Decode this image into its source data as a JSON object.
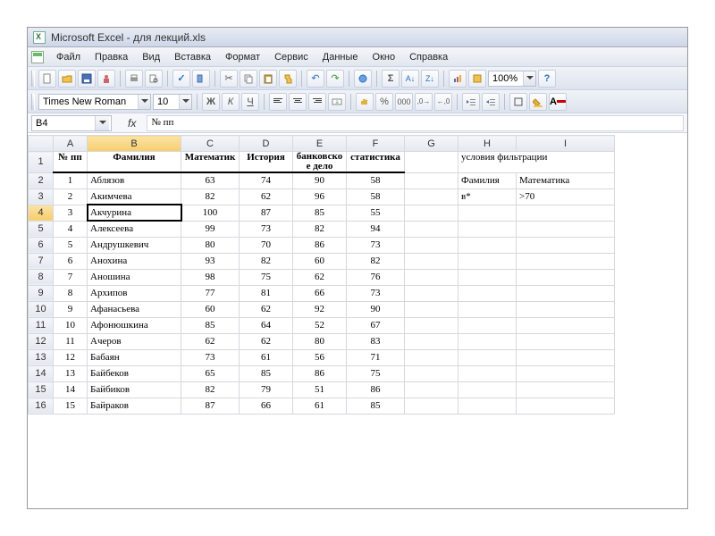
{
  "title": "Microsoft Excel - для лекций.xls",
  "menus": [
    "Файл",
    "Правка",
    "Вид",
    "Вставка",
    "Формат",
    "Сервис",
    "Данные",
    "Окно",
    "Справка"
  ],
  "zoom": "100%",
  "font": {
    "name": "Times New Roman",
    "size": "10"
  },
  "namebox": "B4",
  "fx_label": "fx",
  "formula": "№ пп",
  "columns": [
    "A",
    "B",
    "C",
    "D",
    "E",
    "F",
    "G",
    "H",
    "I"
  ],
  "header_row": {
    "A": "№ пп",
    "B": "Фамилия",
    "C": "Математика",
    "D": "История",
    "E": "банковское дело",
    "F": "статистика",
    "H_caption": "условия фильтрации"
  },
  "filter_row": {
    "H": "Фамилия",
    "I": "Математика"
  },
  "filter_row2": {
    "H": "в*",
    "I": ">70"
  },
  "rows": [
    {
      "n": 1,
      "name": "Аблязов",
      "m": 63,
      "h": 74,
      "b": 90,
      "s": 58
    },
    {
      "n": 2,
      "name": "Акимчева",
      "m": 82,
      "h": 62,
      "b": 96,
      "s": 58
    },
    {
      "n": 3,
      "name": "Акчурина",
      "m": 100,
      "h": 87,
      "b": 85,
      "s": 55
    },
    {
      "n": 4,
      "name": "Алексеева",
      "m": 99,
      "h": 73,
      "b": 82,
      "s": 94
    },
    {
      "n": 5,
      "name": "Андрушкевич",
      "m": 80,
      "h": 70,
      "b": 86,
      "s": 73
    },
    {
      "n": 6,
      "name": "Анохина",
      "m": 93,
      "h": 82,
      "b": 60,
      "s": 82
    },
    {
      "n": 7,
      "name": "Аношина",
      "m": 98,
      "h": 75,
      "b": 62,
      "s": 76
    },
    {
      "n": 8,
      "name": "Архипов",
      "m": 77,
      "h": 81,
      "b": 66,
      "s": 73
    },
    {
      "n": 9,
      "name": "Афанасьева",
      "m": 60,
      "h": 62,
      "b": 92,
      "s": 90
    },
    {
      "n": 10,
      "name": "Афонюшкина",
      "m": 85,
      "h": 64,
      "b": 52,
      "s": 67
    },
    {
      "n": 11,
      "name": "Ачеров",
      "m": 62,
      "h": 62,
      "b": 80,
      "s": 83
    },
    {
      "n": 12,
      "name": "Бабаян",
      "m": 73,
      "h": 61,
      "b": 56,
      "s": 71
    },
    {
      "n": 13,
      "name": "Байбеков",
      "m": 65,
      "h": 85,
      "b": 86,
      "s": 75
    },
    {
      "n": 14,
      "name": "Байбиков",
      "m": 82,
      "h": 79,
      "b": 51,
      "s": 86
    },
    {
      "n": 15,
      "name": "Байраков",
      "m": 87,
      "h": 66,
      "b": 61,
      "s": 85
    }
  ],
  "active_cell": {
    "row": 4,
    "col": "B"
  },
  "toolbar_icons": [
    "new",
    "open",
    "save",
    "permissions",
    "print",
    "preview",
    "spelling",
    "research",
    "cut",
    "copy",
    "paste",
    "format-painter",
    "undo",
    "redo",
    "link",
    "autosum",
    "sort-asc",
    "sort-desc",
    "chart",
    "drawing"
  ],
  "format_icons": [
    "bold",
    "italic",
    "underline",
    "align-left",
    "align-center",
    "align-right",
    "merge",
    "currency",
    "percent",
    "comma",
    "inc-dec",
    "dec-dec",
    "dec-indent",
    "inc-indent",
    "borders",
    "fill-color",
    "font-color"
  ]
}
